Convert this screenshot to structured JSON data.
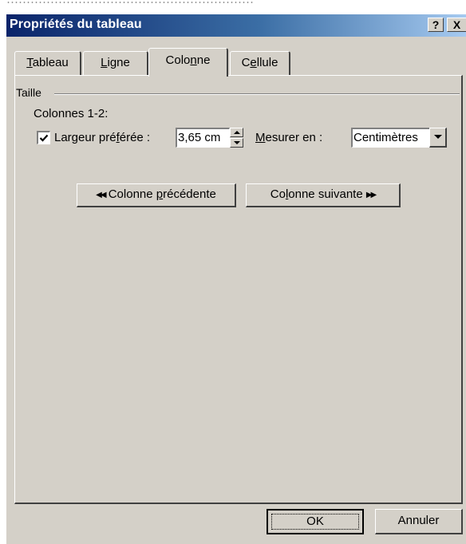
{
  "dialog": {
    "title": "Propriétés du tableau",
    "help_label": "?",
    "close_label": "X"
  },
  "tabs": [
    {
      "label": "Tableau",
      "accesskey": "T",
      "active": false
    },
    {
      "label": "Ligne",
      "accesskey": "L",
      "active": false
    },
    {
      "label": "Colonne",
      "accesskey": "n",
      "active": true
    },
    {
      "label": "Cellule",
      "accesskey": "e",
      "active": false
    }
  ],
  "column_tab": {
    "group_label": "Taille",
    "columns_label": "Colonnes 1-2:",
    "preferred_width": {
      "checked": true,
      "label_pre": "Largeur pré",
      "label_accel": "f",
      "label_post": "érée :",
      "value": "3,65 cm"
    },
    "measure": {
      "label_accel": "M",
      "label_post": "esurer en :",
      "value": "Centimètres"
    },
    "prev_button": {
      "arrows": "◀◀",
      "pre": "Colonne ",
      "accel": "p",
      "post": "récédente"
    },
    "next_button": {
      "arrows": "▶▶",
      "pre": "Co",
      "accel": "l",
      "post": "onne suivante"
    }
  },
  "footer": {
    "ok_label": "OK",
    "cancel_label": "Annuler"
  }
}
